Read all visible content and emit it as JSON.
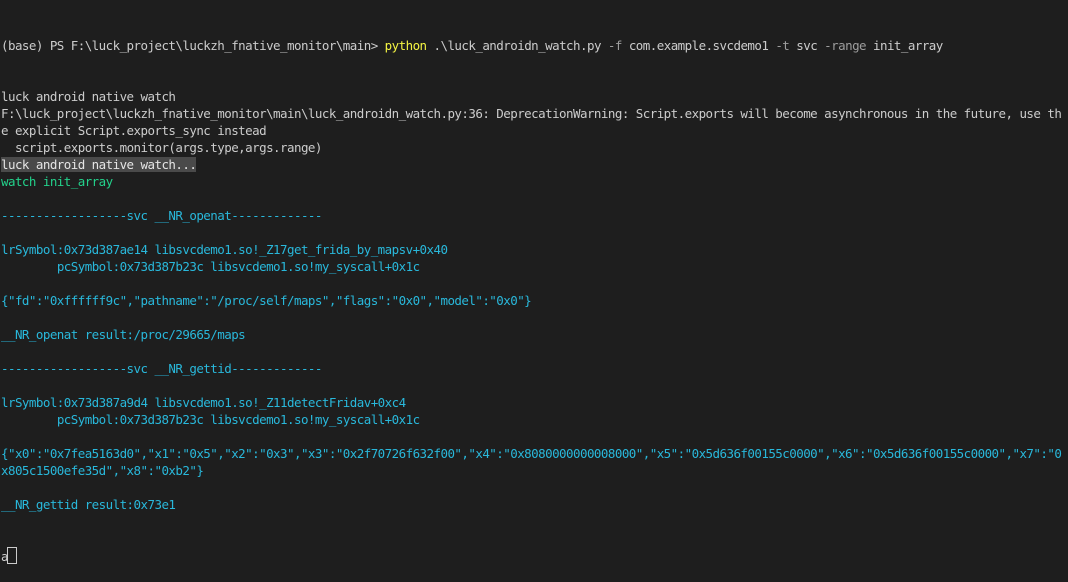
{
  "terminal": {
    "prompt": "(base) PS F:\\luck_project\\luckzh_fnative_monitor\\main> ",
    "command": "python",
    "command_args": [
      {
        "text": " .\\luck_androidn_watch.py ",
        "kind": "arg"
      },
      {
        "text": "-f",
        "kind": "flag"
      },
      {
        "text": " com.example.svcdemo1 ",
        "kind": "arg"
      },
      {
        "text": "-t",
        "kind": "flag"
      },
      {
        "text": " svc ",
        "kind": "arg"
      },
      {
        "text": "-range",
        "kind": "flag"
      },
      {
        "text": " init_array",
        "kind": "arg"
      }
    ],
    "lines": [
      {
        "text": "luck android native watch",
        "style": "normal"
      },
      {
        "text": "F:\\luck_project\\luckzh_fnative_monitor\\main\\luck_androidn_watch.py:36: DeprecationWarning: Script.exports will become asynchronous in the future, use the explicit Script.exports_sync instead",
        "style": "normal"
      },
      {
        "text": "  script.exports.monitor(args.type,args.range)",
        "style": "normal"
      },
      {
        "text": "luck android native watch...",
        "style": "highlight"
      },
      {
        "text": "watch init_array",
        "style": "green"
      },
      {
        "text": "",
        "style": "cyan"
      },
      {
        "text": "------------------svc __NR_openat-------------",
        "style": "cyan"
      },
      {
        "text": "",
        "style": "cyan"
      },
      {
        "text": "lrSymbol:0x73d387ae14 libsvcdemo1.so!_Z17get_frida_by_mapsv+0x40",
        "style": "cyan"
      },
      {
        "text": "        pcSymbol:0x73d387b23c libsvcdemo1.so!my_syscall+0x1c",
        "style": "cyan"
      },
      {
        "text": "",
        "style": "cyan"
      },
      {
        "text": "{\"fd\":\"0xffffff9c\",\"pathname\":\"/proc/self/maps\",\"flags\":\"0x0\",\"model\":\"0x0\"}",
        "style": "cyan"
      },
      {
        "text": "",
        "style": "cyan"
      },
      {
        "text": "__NR_openat result:/proc/29665/maps",
        "style": "cyan"
      },
      {
        "text": "",
        "style": "cyan"
      },
      {
        "text": "------------------svc __NR_gettid-------------",
        "style": "cyan"
      },
      {
        "text": "",
        "style": "cyan"
      },
      {
        "text": "lrSymbol:0x73d387a9d4 libsvcdemo1.so!_Z11detectFridav+0xc4",
        "style": "cyan"
      },
      {
        "text": "        pcSymbol:0x73d387b23c libsvcdemo1.so!my_syscall+0x1c",
        "style": "cyan"
      },
      {
        "text": "",
        "style": "cyan"
      },
      {
        "text": "{\"x0\":\"0x7fea5163d0\",\"x1\":\"0x5\",\"x2\":\"0x3\",\"x3\":\"0x2f70726f632f00\",\"x4\":\"0x8080000000008000\",\"x5\":\"0x5d636f00155c0000\",\"x6\":\"0x5d636f00155c0000\",\"x7\":\"0x805c1500efe35d\",\"x8\":\"0xb2\"}",
        "style": "cyan"
      },
      {
        "text": "",
        "style": "cyan"
      },
      {
        "text": "__NR_gettid result:0x73e1",
        "style": "cyan"
      }
    ],
    "input_text": "a"
  },
  "colors": {
    "background": "#1e1e1e",
    "foreground": "#cccccc",
    "command": "#f5f543",
    "flag": "#9e9e9e",
    "green": "#23d18b",
    "cyan": "#29b8db",
    "highlight_bg": "#4a4a4a"
  }
}
